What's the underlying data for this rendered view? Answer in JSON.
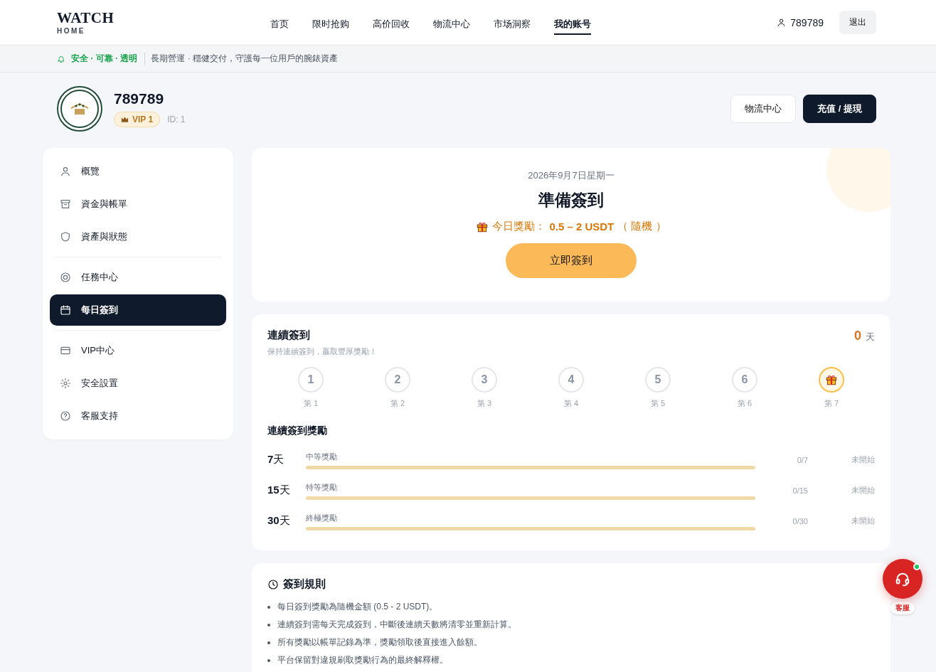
{
  "brand": {
    "title": "WATCH",
    "subtitle": "HOME"
  },
  "nav": [
    {
      "label": "首页",
      "selected": false
    },
    {
      "label": "限时抢购",
      "selected": false
    },
    {
      "label": "高价回收",
      "selected": false
    },
    {
      "label": "物流中心",
      "selected": false
    },
    {
      "label": "市场洞察",
      "selected": false
    },
    {
      "label": "我的账号",
      "selected": true
    }
  ],
  "user": {
    "name": "789789",
    "logout": "退出"
  },
  "banner": {
    "highlight": "安全 · 可靠 · 透明",
    "text": "長期營運 · 穩健交付，守護每一位用戶的腕錶資產"
  },
  "profile": {
    "name": "789789",
    "vip": "VIP 1",
    "id": "ID: 1",
    "buttons": [
      {
        "label": "物流中心",
        "kind": "outline"
      },
      {
        "label": "充值 / 提現",
        "kind": "solid"
      }
    ]
  },
  "sidebar": {
    "groups": [
      [
        {
          "label": "概覽",
          "selected": false
        },
        {
          "label": "資金與帳單",
          "selected": false
        },
        {
          "label": "資產與狀態",
          "selected": false
        }
      ],
      [
        {
          "label": "任務中心",
          "selected": false
        },
        {
          "label": "每日簽到",
          "selected": true
        }
      ],
      [
        {
          "label": "VIP中心",
          "selected": false
        },
        {
          "label": "安全設置",
          "selected": false
        },
        {
          "label": "客服支持",
          "selected": false
        }
      ]
    ]
  },
  "checkin": {
    "date": "2026年9月7日星期一",
    "title": "準備簽到",
    "reward_label": "今日獎勵：",
    "reward_value": "0.5 – 2 USDT",
    "reward_note": "（ 隨機 ）",
    "button": "立即簽到"
  },
  "streak": {
    "title": "連續簽到",
    "subtitle": "保持連續簽到，贏取豐厚獎勵！",
    "count": "0",
    "unit": "天",
    "days": [
      {
        "kind": "number",
        "number": "1",
        "label": "第 1"
      },
      {
        "kind": "number",
        "number": "2",
        "label": "第 2"
      },
      {
        "kind": "number",
        "number": "3",
        "label": "第 3"
      },
      {
        "kind": "number",
        "number": "4",
        "label": "第 4"
      },
      {
        "kind": "number",
        "number": "5",
        "label": "第 5"
      },
      {
        "kind": "number",
        "number": "6",
        "label": "第 6"
      },
      {
        "kind": "gift",
        "label": "第 7"
      }
    ],
    "rewards_title": "連續簽到獎勵",
    "rewards": [
      {
        "days": "7",
        "unit": "天",
        "name": "中等獎勵",
        "level": 0,
        "progress": "0/7",
        "status": "未開始"
      },
      {
        "days": "15",
        "unit": "天",
        "name": "特等獎勵",
        "level": 0,
        "progress": "0/15",
        "status": "未開始"
      },
      {
        "days": "30",
        "unit": "天",
        "name": "終極獎勵",
        "level": 0,
        "progress": "0/30",
        "status": "未開始"
      }
    ]
  },
  "rules": {
    "title": "簽到規則",
    "items": [
      "每日簽到獎勵為隨機金額 (0.5 - 2 USDT)。",
      "連續簽到需每天完成簽到，中斷後連續天數將清零並重新計算。",
      "所有獎勵以帳單記錄為準，獎勵領取後直接進入餘額。",
      "平台保留對違規刷取獎勵行為的最終解釋權。"
    ]
  },
  "support": {
    "label": "客服",
    "online": true
  }
}
